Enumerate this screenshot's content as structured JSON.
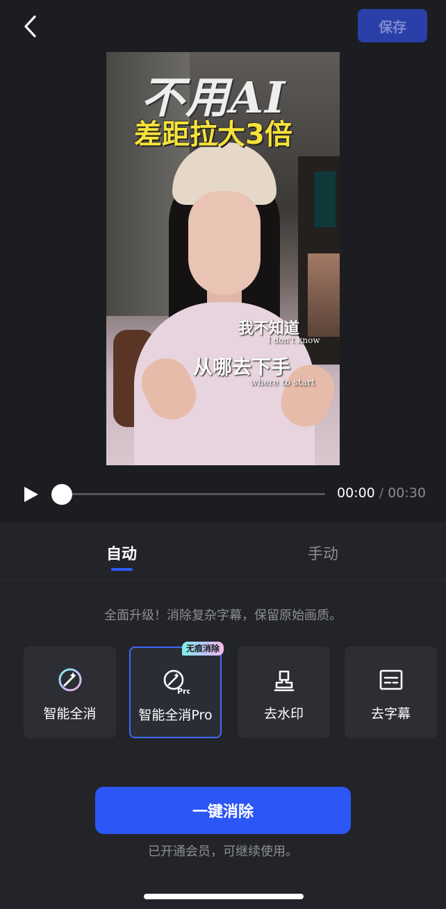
{
  "header": {
    "back_icon": "chevron-left-icon",
    "save_label": "保存"
  },
  "video": {
    "caption_large": "不用AI",
    "caption_yellow": "差距拉大3倍",
    "subtitle_1_cn": "我不知道",
    "subtitle_1_en": "I don't know",
    "subtitle_2_cn": "从哪去下手",
    "subtitle_2_en": "where to start"
  },
  "player": {
    "play_icon": "play-icon",
    "progress": 0,
    "current_time": "00:00",
    "separator": "/",
    "total_time": "00:30"
  },
  "tabs": {
    "auto": "自动",
    "manual": "手动",
    "active": "auto"
  },
  "description": "全面升级！消除复杂字幕，保留原始画质。",
  "options": [
    {
      "label": "智能全消",
      "icon": "magic-wand-icon"
    },
    {
      "label": "智能全消Pro",
      "icon": "magic-wand-pro-icon",
      "badge": "无痕消除",
      "selected": true
    },
    {
      "label": "去水印",
      "icon": "stamp-icon"
    },
    {
      "label": "去字幕",
      "icon": "subtitle-icon"
    }
  ],
  "primary_button": "一键消除",
  "member_note": "已开通会员，可继续使用。",
  "colors": {
    "background": "#1c1d21",
    "panel": "#22242a",
    "accent": "#2c56f5",
    "save_disabled": "#2b3fa8"
  }
}
